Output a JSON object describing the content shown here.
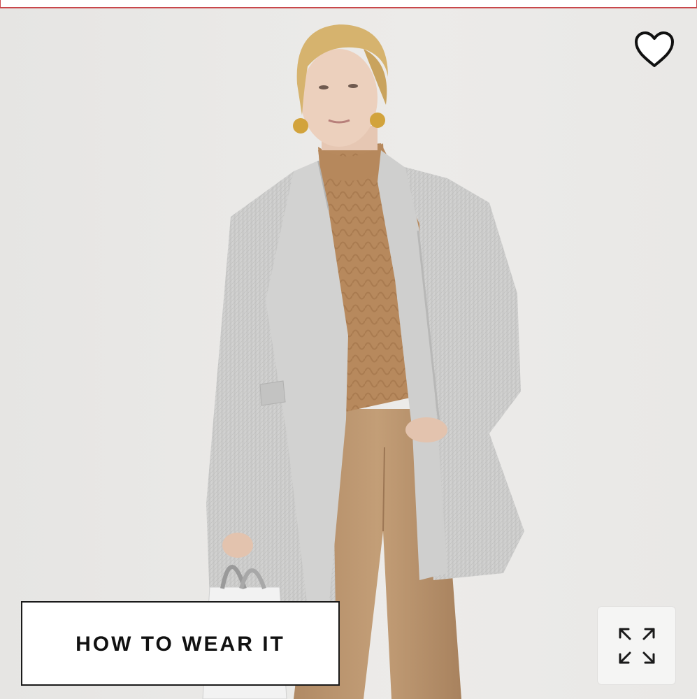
{
  "product_image": {
    "alt": "",
    "background_color": "#e9e8e6"
  },
  "wishlist": {
    "icon": "heart-outline-icon"
  },
  "how_to_wear": {
    "label": "HOW TO WEAR IT"
  },
  "expand": {
    "icon": "expand-arrows-icon"
  },
  "colors": {
    "accent_rule": "#c9474b",
    "button_border": "#1a1a1a",
    "button_text": "#111111"
  }
}
